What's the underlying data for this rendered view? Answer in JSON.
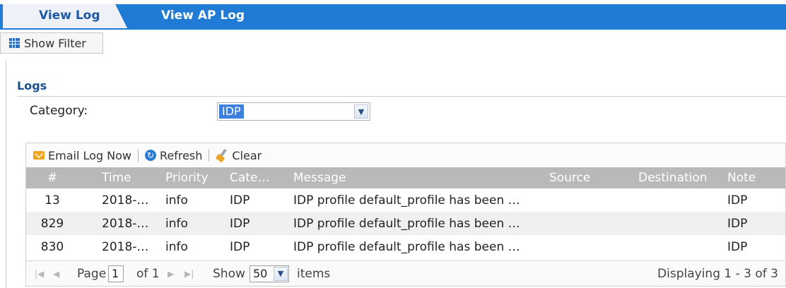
{
  "tabs": [
    {
      "label": "View Log",
      "active": true
    },
    {
      "label": "View AP Log",
      "active": false
    }
  ],
  "filter_button": {
    "label": "Show Filter",
    "icon": "filter-grid-icon"
  },
  "section": {
    "title": "Logs"
  },
  "category": {
    "label": "Category:",
    "selected": "IDP"
  },
  "toolbar": {
    "email_label": "Email Log Now",
    "refresh_label": "Refresh",
    "clear_label": "Clear"
  },
  "table": {
    "headers": [
      "#",
      "Time",
      "Priority",
      "Cate…",
      "Message",
      "Source",
      "Destination",
      "Note"
    ],
    "rows": [
      [
        "13",
        "2018-…",
        "info",
        "IDP",
        "IDP profile default_profile has been …",
        "",
        "",
        "IDP"
      ],
      [
        "829",
        "2018-…",
        "info",
        "IDP",
        "IDP profile default_profile has been …",
        "",
        "",
        "IDP"
      ],
      [
        "830",
        "2018-…",
        "info",
        "IDP",
        "IDP profile default_profile has been …",
        "",
        "",
        "IDP"
      ]
    ]
  },
  "pager": {
    "page_label": "Page",
    "page_value": "1",
    "of_label": "of 1",
    "show_label": "Show",
    "show_value": "50",
    "items_label": "items",
    "display_text": "Displaying 1 - 3 of 3"
  },
  "colors": {
    "accent_blue": "#1f7bd3",
    "header_gray": "#b9b9b9",
    "select_highlight": "#3c7fdc"
  }
}
